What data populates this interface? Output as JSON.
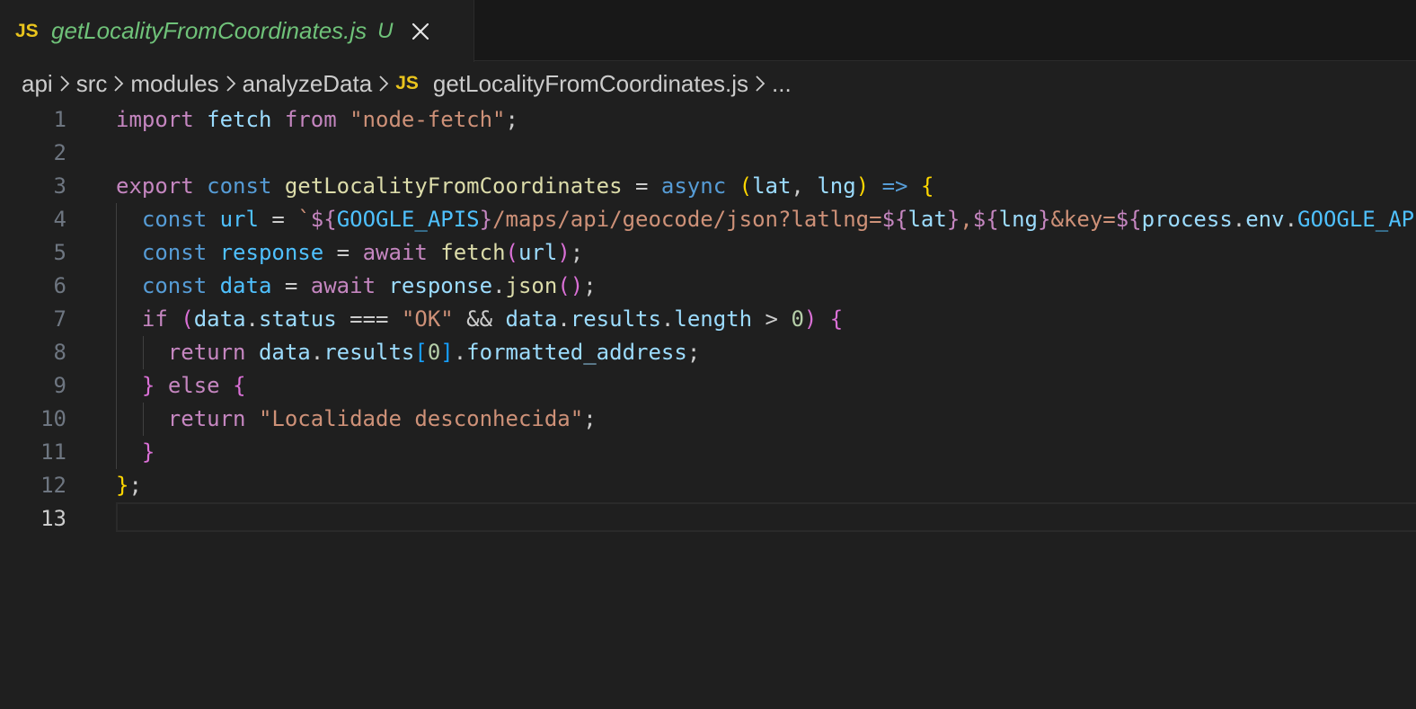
{
  "tab": {
    "icon_label": "JS",
    "title": "getLocalityFromCoordinates.js",
    "status": "U"
  },
  "breadcrumbs": {
    "items": [
      "api",
      "src",
      "modules",
      "analyzeData"
    ],
    "file_icon_label": "JS",
    "file": "getLocalityFromCoordinates.js",
    "more": "..."
  },
  "editor": {
    "active_line": 13,
    "lines": [
      {
        "n": "1",
        "tokens": [
          [
            "kw",
            "import"
          ],
          [
            "pl",
            " "
          ],
          [
            "var",
            "fetch"
          ],
          [
            "pl",
            " "
          ],
          [
            "kw",
            "from"
          ],
          [
            "pl",
            " "
          ],
          [
            "str",
            "\"node-fetch\""
          ],
          [
            "pl",
            ";"
          ]
        ]
      },
      {
        "n": "2",
        "tokens": []
      },
      {
        "n": "3",
        "tokens": [
          [
            "kw",
            "export"
          ],
          [
            "pl",
            " "
          ],
          [
            "st",
            "const"
          ],
          [
            "pl",
            " "
          ],
          [
            "fn",
            "getLocalityFromCoordinates"
          ],
          [
            "pl",
            " = "
          ],
          [
            "st",
            "async"
          ],
          [
            "pl",
            " "
          ],
          [
            "b1",
            "("
          ],
          [
            "var",
            "lat"
          ],
          [
            "pl",
            ", "
          ],
          [
            "var",
            "lng"
          ],
          [
            "b1",
            ")"
          ],
          [
            "pl",
            " "
          ],
          [
            "st",
            "=>"
          ],
          [
            "pl",
            " "
          ],
          [
            "b1",
            "{"
          ]
        ]
      },
      {
        "n": "4",
        "tokens": [
          [
            "pl",
            "  "
          ],
          [
            "st",
            "const"
          ],
          [
            "pl",
            " "
          ],
          [
            "cst",
            "url"
          ],
          [
            "pl",
            " = "
          ],
          [
            "str",
            "`"
          ],
          [
            "kw",
            "${"
          ],
          [
            "cst",
            "GOOGLE_APIS"
          ],
          [
            "kw",
            "}"
          ],
          [
            "str",
            "/maps/api/geocode/json?latlng="
          ],
          [
            "kw",
            "${"
          ],
          [
            "var",
            "lat"
          ],
          [
            "kw",
            "}"
          ],
          [
            "str",
            ","
          ],
          [
            "kw",
            "${"
          ],
          [
            "var",
            "lng"
          ],
          [
            "kw",
            "}"
          ],
          [
            "str",
            "&key="
          ],
          [
            "kw",
            "${"
          ],
          [
            "var",
            "process"
          ],
          [
            "pl",
            "."
          ],
          [
            "var",
            "env"
          ],
          [
            "pl",
            "."
          ],
          [
            "cst",
            "GOOGLE_API_KEY"
          ],
          [
            "kw",
            "}"
          ],
          [
            "str",
            "`"
          ],
          [
            "pl",
            ";"
          ]
        ]
      },
      {
        "n": "5",
        "tokens": [
          [
            "pl",
            "  "
          ],
          [
            "st",
            "const"
          ],
          [
            "pl",
            " "
          ],
          [
            "cst",
            "response"
          ],
          [
            "pl",
            " = "
          ],
          [
            "kw",
            "await"
          ],
          [
            "pl",
            " "
          ],
          [
            "fn",
            "fetch"
          ],
          [
            "b2",
            "("
          ],
          [
            "var",
            "url"
          ],
          [
            "b2",
            ")"
          ],
          [
            "pl",
            ";"
          ]
        ]
      },
      {
        "n": "6",
        "tokens": [
          [
            "pl",
            "  "
          ],
          [
            "st",
            "const"
          ],
          [
            "pl",
            " "
          ],
          [
            "cst",
            "data"
          ],
          [
            "pl",
            " = "
          ],
          [
            "kw",
            "await"
          ],
          [
            "pl",
            " "
          ],
          [
            "var",
            "response"
          ],
          [
            "pl",
            "."
          ],
          [
            "fn",
            "json"
          ],
          [
            "b2",
            "()"
          ],
          [
            "pl",
            ";"
          ]
        ]
      },
      {
        "n": "7",
        "tokens": [
          [
            "pl",
            "  "
          ],
          [
            "kw",
            "if"
          ],
          [
            "pl",
            " "
          ],
          [
            "b2",
            "("
          ],
          [
            "var",
            "data"
          ],
          [
            "pl",
            "."
          ],
          [
            "var",
            "status"
          ],
          [
            "pl",
            " === "
          ],
          [
            "str",
            "\"OK\""
          ],
          [
            "pl",
            " && "
          ],
          [
            "var",
            "data"
          ],
          [
            "pl",
            "."
          ],
          [
            "var",
            "results"
          ],
          [
            "pl",
            "."
          ],
          [
            "var",
            "length"
          ],
          [
            "pl",
            " > "
          ],
          [
            "num",
            "0"
          ],
          [
            "b2",
            ")"
          ],
          [
            "pl",
            " "
          ],
          [
            "b2",
            "{"
          ]
        ]
      },
      {
        "n": "8",
        "tokens": [
          [
            "pl",
            "    "
          ],
          [
            "kw",
            "return"
          ],
          [
            "pl",
            " "
          ],
          [
            "var",
            "data"
          ],
          [
            "pl",
            "."
          ],
          [
            "var",
            "results"
          ],
          [
            "b3",
            "["
          ],
          [
            "num",
            "0"
          ],
          [
            "b3",
            "]"
          ],
          [
            "pl",
            "."
          ],
          [
            "var",
            "formatted_address"
          ],
          [
            "pl",
            ";"
          ]
        ]
      },
      {
        "n": "9",
        "tokens": [
          [
            "pl",
            "  "
          ],
          [
            "b2",
            "}"
          ],
          [
            "pl",
            " "
          ],
          [
            "kw",
            "else"
          ],
          [
            "pl",
            " "
          ],
          [
            "b2",
            "{"
          ]
        ]
      },
      {
        "n": "10",
        "tokens": [
          [
            "pl",
            "    "
          ],
          [
            "kw",
            "return"
          ],
          [
            "pl",
            " "
          ],
          [
            "str",
            "\"Localidade desconhecida\""
          ],
          [
            "pl",
            ";"
          ]
        ]
      },
      {
        "n": "11",
        "tokens": [
          [
            "pl",
            "  "
          ],
          [
            "b2",
            "}"
          ]
        ]
      },
      {
        "n": "12",
        "tokens": [
          [
            "b1",
            "}"
          ],
          [
            "pl",
            ";"
          ]
        ]
      },
      {
        "n": "13",
        "tokens": []
      }
    ]
  },
  "colors": {
    "editor_bg": "#1f1f1f",
    "tab_title": "#6fc279",
    "js_icon": "#e9c41d"
  }
}
